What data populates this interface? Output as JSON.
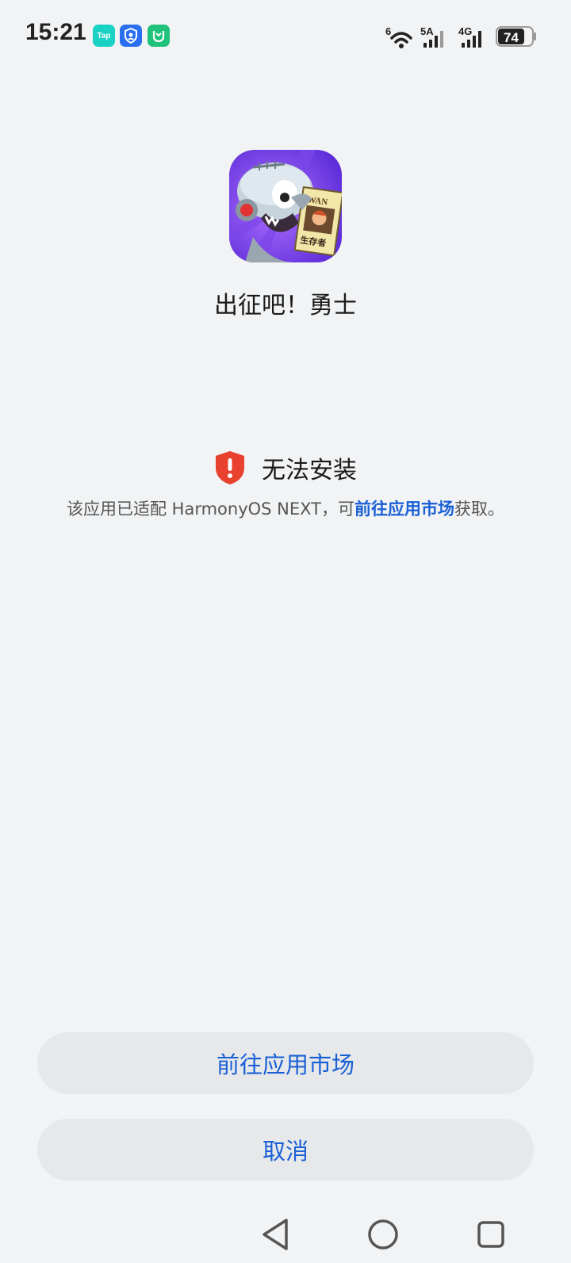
{
  "status_bar": {
    "time": "15:21",
    "notification_icons": [
      {
        "name": "taptap-icon",
        "label": "Tap",
        "color": "#19d2c4"
      },
      {
        "name": "account-shield-icon",
        "label": "",
        "color": "#2a6ff0"
      },
      {
        "name": "mi-home-icon",
        "label": "",
        "color": "#1fc27a"
      }
    ],
    "wifi_label": "6",
    "signal_1_label": "5A",
    "signal_2_label": "4G",
    "battery_percent": "74"
  },
  "app": {
    "name": "出征吧！勇士",
    "icon_text": "WAN",
    "icon_tag": "生存者"
  },
  "warning": {
    "icon": "shield-exclamation-icon",
    "title": "无法安装",
    "desc_prefix": "该应用已适配 HarmonyOS NEXT，可",
    "desc_link": "前往应用市场",
    "desc_suffix": "获取。",
    "icon_color": "#e8412e",
    "link_color": "#1a5fd6"
  },
  "buttons": {
    "market": "前往应用市场",
    "cancel": "取消"
  },
  "nav": {
    "back": "back-triangle-icon",
    "home": "home-circle-icon",
    "recents": "recents-square-icon"
  }
}
